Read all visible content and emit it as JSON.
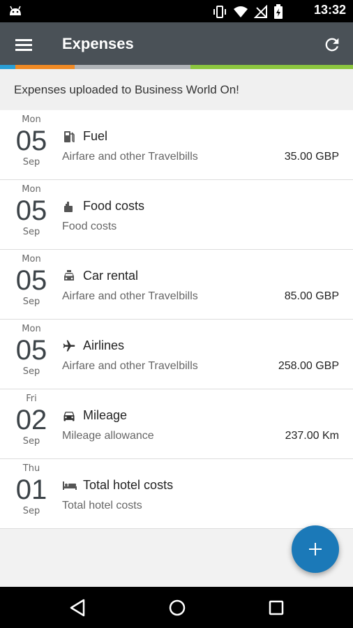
{
  "status_bar": {
    "time": "13:32",
    "icons": [
      "android-icon",
      "vibrate-icon",
      "wifi-icon",
      "no-signal-icon",
      "battery-charging-icon"
    ]
  },
  "app_bar": {
    "title": "Expenses",
    "menu_icon": "hamburger-menu-icon",
    "refresh_icon": "refresh-icon"
  },
  "color_strip": [
    "#2a9fd6",
    "#f08a24",
    "#b0b4b8",
    "#8cc63f"
  ],
  "banner": {
    "text": "Expenses uploaded to Business World On!"
  },
  "expenses": [
    {
      "dow": "Mon",
      "day": "05",
      "month": "Sep",
      "icon": "fuel-pump-icon",
      "title": "Fuel",
      "subtitle": "Airfare and other Travelbills",
      "amount": "35.00 GBP"
    },
    {
      "dow": "Mon",
      "day": "05",
      "month": "Sep",
      "icon": "food-icon",
      "title": "Food costs",
      "subtitle": "Food costs",
      "amount": ""
    },
    {
      "dow": "Mon",
      "day": "05",
      "month": "Sep",
      "icon": "car-rental-icon",
      "title": "Car rental",
      "subtitle": "Airfare and other Travelbills",
      "amount": "85.00 GBP"
    },
    {
      "dow": "Mon",
      "day": "05",
      "month": "Sep",
      "icon": "airplane-icon",
      "title": "Airlines",
      "subtitle": "Airfare and other Travelbills",
      "amount": "258.00 GBP"
    },
    {
      "dow": "Fri",
      "day": "02",
      "month": "Sep",
      "icon": "car-icon",
      "title": "Mileage",
      "subtitle": "Mileage allowance",
      "amount": "237.00 Km"
    },
    {
      "dow": "Thu",
      "day": "01",
      "month": "Sep",
      "icon": "bed-icon",
      "title": "Total hotel costs",
      "subtitle": "Total hotel costs",
      "amount": ""
    }
  ],
  "fab": {
    "icon": "plus-icon"
  },
  "nav_bar": {
    "icons": [
      "back-icon",
      "home-icon",
      "recent-apps-icon"
    ]
  }
}
